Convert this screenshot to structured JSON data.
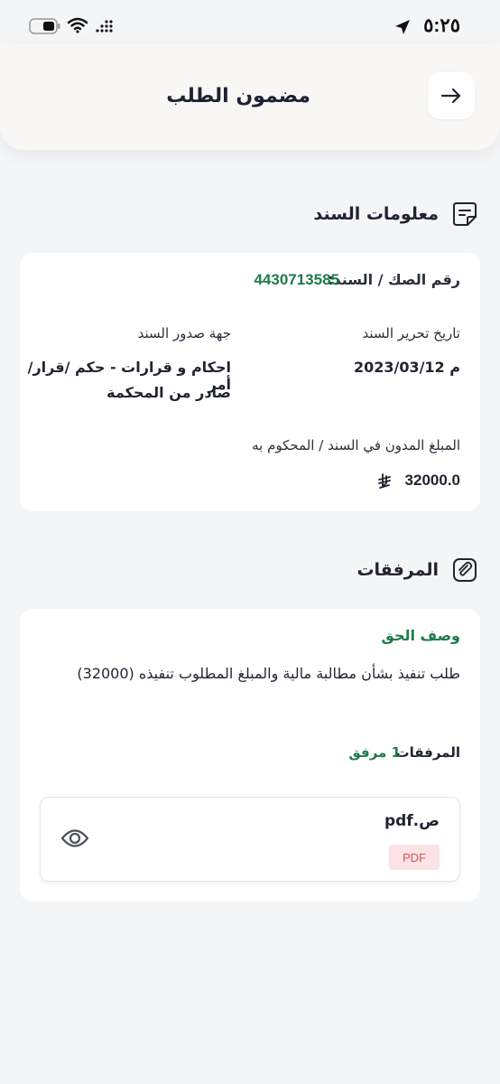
{
  "status_bar": {
    "time": "٥:٢٥"
  },
  "header": {
    "title": "مضمون الطلب"
  },
  "document_info": {
    "section_title": "معلومات السند",
    "deed_number_label": "رقم الصك / السند:",
    "deed_number_value": "4430713585",
    "issue_date_label": "تاريخ تحرير السند",
    "issue_date_value": "2023/03/12 م",
    "issuer_label": "جهة صدور السند",
    "issuer_value_line1": "احكام و قرارات - حكم /قرار/ أمر",
    "issuer_value_line2": "صادر من المحكمة",
    "amount_label": "المبلغ المدون في السند / المحكوم به",
    "amount_value": "32000.0"
  },
  "attachments": {
    "section_title": "المرفقات",
    "right_description_label": "وصف الحق",
    "right_description_value": "طلب تنفيذ بشأن مطالبة مالية والمبلغ المطلوب تنفيذه  (32000)",
    "attachments_label": "المرفقات",
    "attachments_count": "1 مرفق",
    "file": {
      "name": "ص.pdf",
      "type_badge": "PDF"
    }
  },
  "colors": {
    "accent_green": "#1f7a4a",
    "pdf_badge_bg": "#fbe3e5",
    "pdf_badge_text": "#d15562"
  }
}
